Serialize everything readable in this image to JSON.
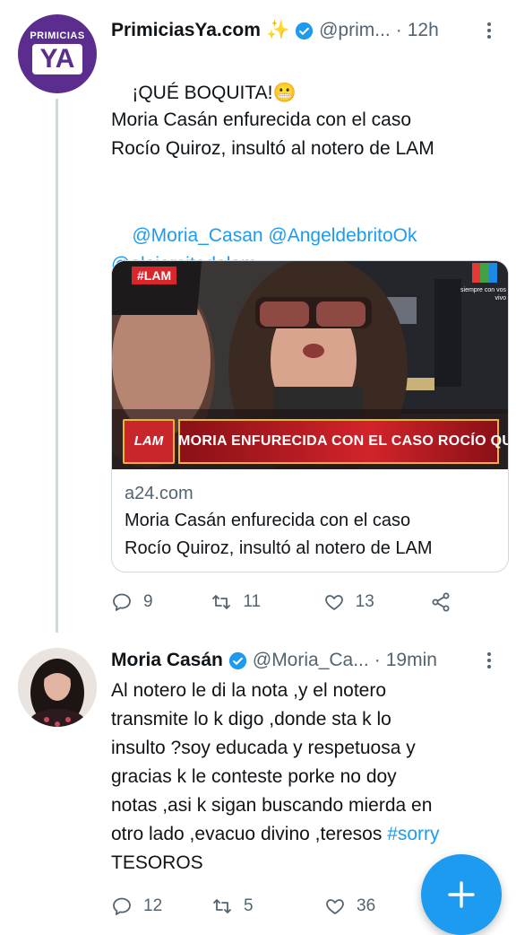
{
  "tweets": [
    {
      "author_name": "PrimiciasYa.com",
      "author_emoji": "✨",
      "handle": "@prim...",
      "time": "12h",
      "avatar_label_top": "PRIMICIAS",
      "avatar_label_main": "YA",
      "text_line1": "¡QUÉ BOQUITA!",
      "text_line1_emoji": "😬",
      "text_body": "Moria Casán enfurecida con el caso\nRocío Quiroz, insultó al notero de LAM",
      "mentions": [
        "@Moria_Casan",
        "@AngeldebritoOk",
        "@elejercitodelam"
      ],
      "card": {
        "image_badge": "#LAM",
        "image_channel_text": "siempre con vos\nvivo",
        "image_logo": "LAM",
        "image_banner": "MORIA ENFURECIDA CON EL CASO ROCÍO QUIROZ",
        "domain": "a24.com",
        "title": "Moria Casán enfurecida con el caso\nRocío Quiroz, insultó al notero de LAM"
      },
      "replies": "9",
      "retweets": "11",
      "likes": "13"
    },
    {
      "author_name": "Moria Casán",
      "handle": "@Moria_Ca...",
      "time": "19min",
      "text": "Al notero le di la nota ,y el notero\ntransmite lo k digo ,donde sta k lo\ninsulto ?soy educada y respetuosa y\ngracias k le conteste porke no doy\nnotas ,asi k sigan buscando mierda en\notro lado ,evacuo divino ,teresos ",
      "hashtag": "#sorry",
      "text_end": "\nTESOROS",
      "replies": "12",
      "retweets": "5",
      "likes": "36"
    }
  ],
  "colors": {
    "accent": "#1d9bf0",
    "muted": "#536471",
    "verified": "#1d9bf0",
    "avatar_bg": "#5b2d8e"
  },
  "icons": [
    "verified-icon",
    "more-icon",
    "reply-icon",
    "retweet-icon",
    "like-icon",
    "share-icon",
    "compose-plus-icon"
  ]
}
